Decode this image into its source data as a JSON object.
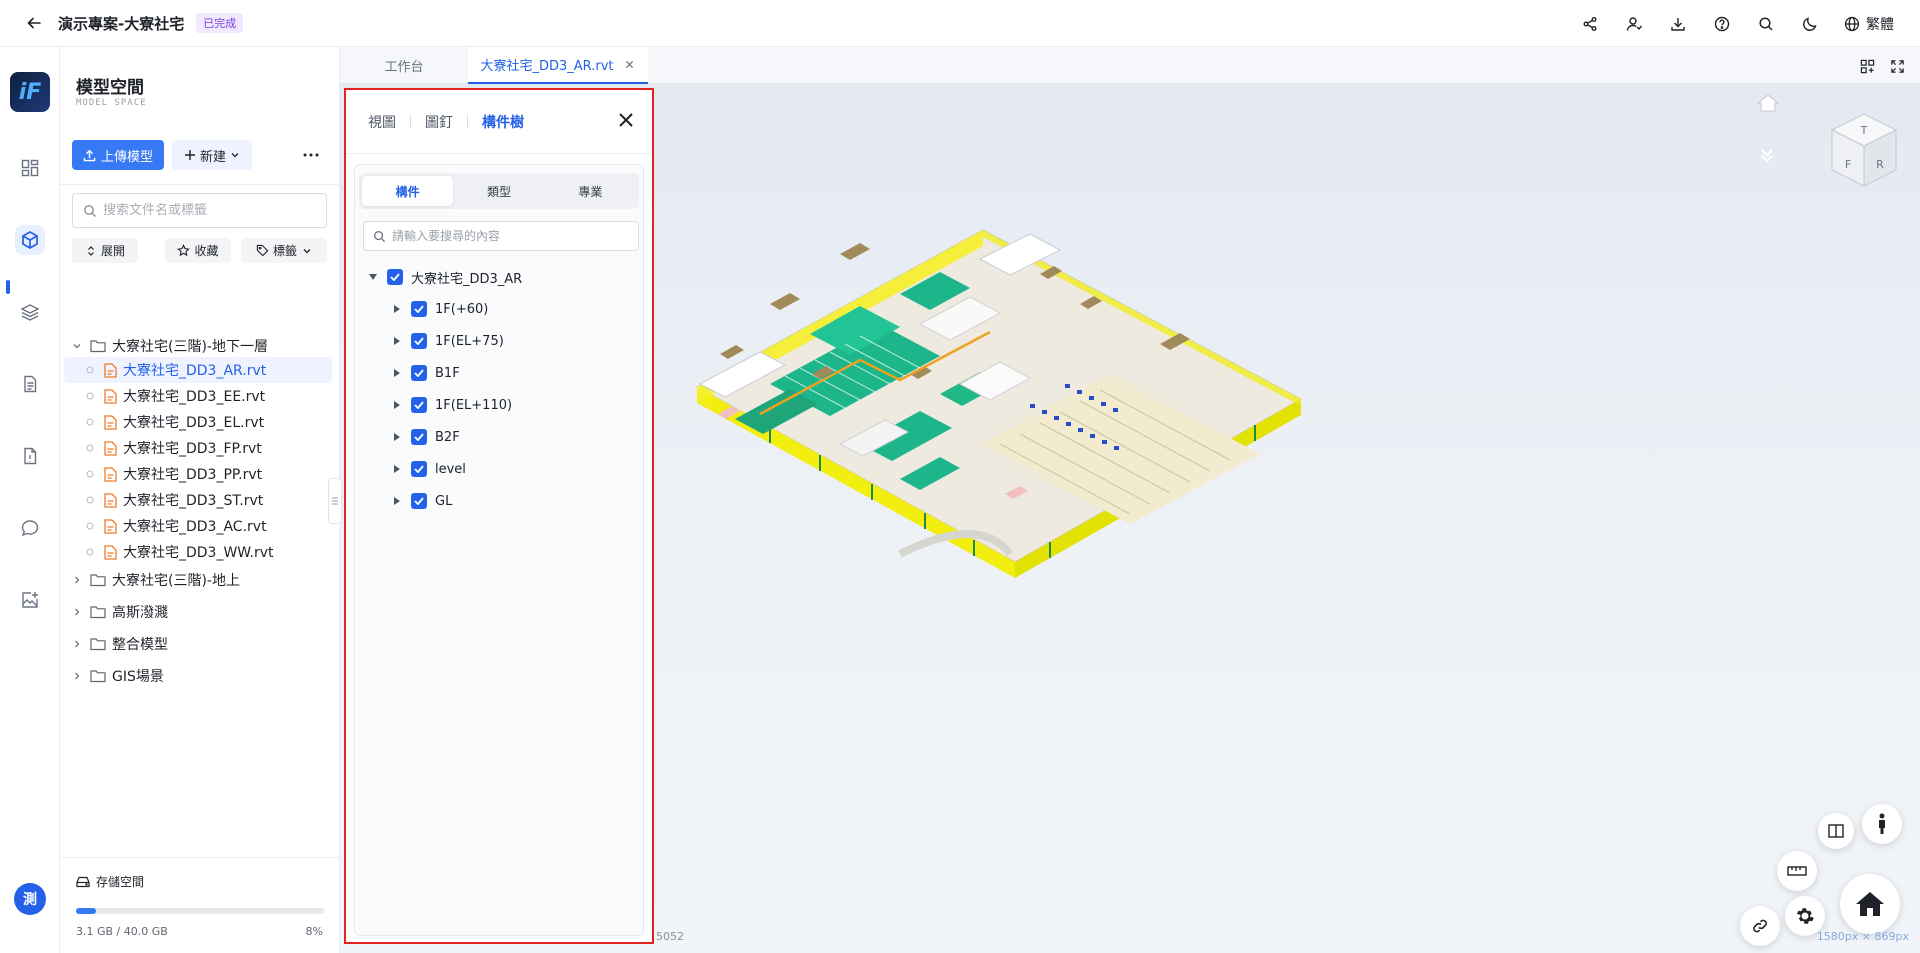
{
  "header": {
    "project_title": "演示專案-大寮社宅",
    "status_badge": "已完成",
    "lang_label": "繁體",
    "icons": [
      "share-icon",
      "user-switch-icon",
      "download-icon",
      "help-icon",
      "search-icon",
      "moon-icon",
      "globe-icon"
    ]
  },
  "rail": {
    "logo_text": "iF",
    "items": [
      "dashboard-icon",
      "model-cube-icon",
      "layers-icon",
      "document-icon",
      "file-report-icon",
      "chat-icon",
      "image-add-icon"
    ],
    "active": "model-cube-icon",
    "avatar_text": "測"
  },
  "file_panel": {
    "title": "模型空間",
    "subtitle": "MODEL SPACE",
    "upload_label": "上傳模型",
    "new_label": "新建",
    "search_placeholder": "搜索文件名或標籤",
    "filters": {
      "expand": "展開",
      "favorite": "收藏",
      "tags": "標籤"
    },
    "tree": [
      {
        "label": "大寮社宅(三階)-地下一層",
        "type": "folder",
        "expanded": true
      },
      {
        "label": "大寮社宅_DD3_AR.rvt",
        "type": "file",
        "selected": true
      },
      {
        "label": "大寮社宅_DD3_EE.rvt",
        "type": "file"
      },
      {
        "label": "大寮社宅_DD3_EL.rvt",
        "type": "file"
      },
      {
        "label": "大寮社宅_DD3_FP.rvt",
        "type": "file"
      },
      {
        "label": "大寮社宅_DD3_PP.rvt",
        "type": "file"
      },
      {
        "label": "大寮社宅_DD3_ST.rvt",
        "type": "file"
      },
      {
        "label": "大寮社宅_DD3_AC.rvt",
        "type": "file"
      },
      {
        "label": "大寮社宅_DD3_WW.rvt",
        "type": "file"
      },
      {
        "label": "大寮社宅(三階)-地上",
        "type": "folder"
      },
      {
        "label": "高斯潑濺",
        "type": "folder"
      },
      {
        "label": "整合模型",
        "type": "folder"
      },
      {
        "label": "GIS場景",
        "type": "folder"
      }
    ],
    "storage": {
      "label": "存儲空間",
      "used": "3.1 GB / 40.0 GB",
      "percent_text": "8%",
      "fraction": 0.08
    }
  },
  "tabs": [
    {
      "label": "工作台",
      "active": false
    },
    {
      "label": "大寮社宅_DD3_AR.rvt",
      "active": true
    }
  ],
  "component_panel": {
    "tabs": [
      {
        "label": "視圖",
        "active": false
      },
      {
        "label": "圖釘",
        "active": false
      },
      {
        "label": "構件樹",
        "active": true
      }
    ],
    "segments": [
      {
        "label": "構件",
        "active": true
      },
      {
        "label": "類型",
        "active": false
      },
      {
        "label": "專業",
        "active": false
      }
    ],
    "search_placeholder": "請輸入要搜尋的內容",
    "tree": [
      {
        "label": "大寮社宅_DD3_AR",
        "level": 0,
        "expanded": true,
        "checked": true
      },
      {
        "label": "1F(+60)",
        "level": 1,
        "checked": true
      },
      {
        "label": "1F(EL+75)",
        "level": 1,
        "checked": true
      },
      {
        "label": "B1F",
        "level": 1,
        "checked": true
      },
      {
        "label": "1F(EL+110)",
        "level": 1,
        "checked": true
      },
      {
        "label": "B2F",
        "level": 1,
        "checked": true
      },
      {
        "label": "level",
        "level": 1,
        "checked": true
      },
      {
        "label": "GL",
        "level": 1,
        "checked": true
      }
    ]
  },
  "viewport": {
    "readout_partial": "5052",
    "size_readout": "1580px × 869px",
    "nav_cube_faces": [
      "T",
      "F",
      "R"
    ]
  }
}
